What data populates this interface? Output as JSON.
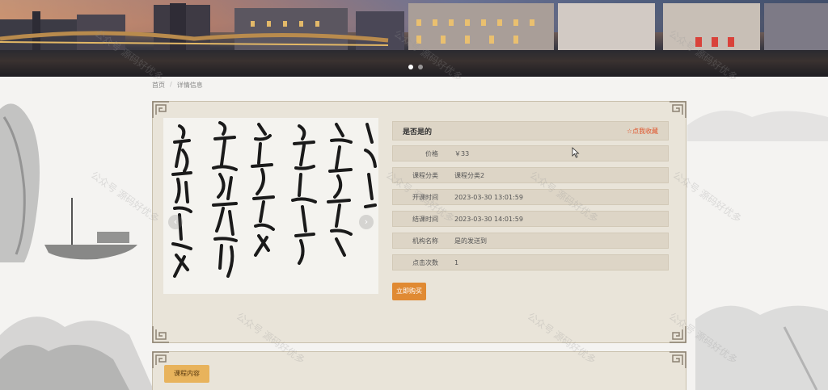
{
  "banner": {
    "slides": 2,
    "active_slide": 1
  },
  "breadcrumb": {
    "home": "首页",
    "separator": "/",
    "current": "详情信息"
  },
  "detail": {
    "title": "是否是的",
    "favorite_label": "☆点我收藏",
    "fields": [
      {
        "label": "价格",
        "value": "￥33"
      },
      {
        "label": "课程分类",
        "value": "课程分类2"
      },
      {
        "label": "开课时间",
        "value": "2023-03-30 13:01:59"
      },
      {
        "label": "结课时间",
        "value": "2023-03-30 14:01:59"
      },
      {
        "label": "机构名称",
        "value": "是的发送到"
      },
      {
        "label": "点击次数",
        "value": "1"
      }
    ],
    "buy_label": "立即购买",
    "image_prev": "‹",
    "image_next": "›"
  },
  "content_tab": {
    "label": "课程内容"
  },
  "watermark": "公众号 源码好优多",
  "colors": {
    "accent": "#e08a33",
    "favorite": "#e0542b",
    "panel": "#e9e4d9",
    "row": "#ddd5c6"
  }
}
